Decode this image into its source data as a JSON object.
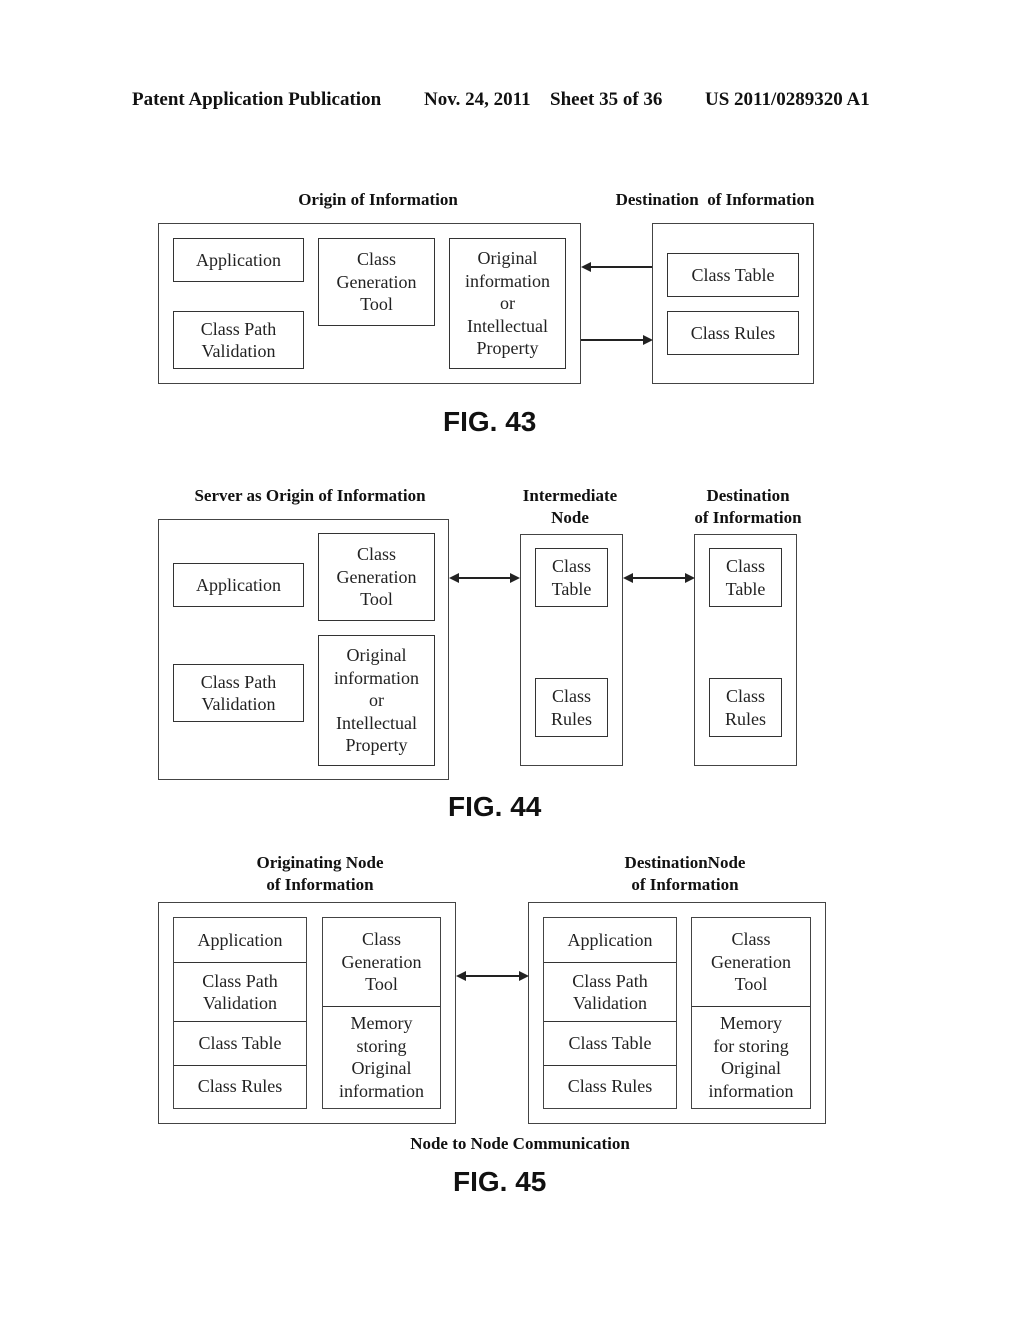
{
  "header": {
    "publication": "Patent Application Publication",
    "date": "Nov. 24, 2011",
    "sheet": "Sheet 35 of 36",
    "number": "US 2011/0289320 A1"
  },
  "fig43": {
    "origin_title": "Origin of Information",
    "destination_title": "Destination  of Information",
    "origin_boxes": {
      "application": "Application",
      "class_path_validation": "Class Path\nValidation",
      "class_generation_tool": "Class\nGeneration\nTool",
      "original_information": "Original\ninformation\nor\nIntellectual\nProperty"
    },
    "destination_boxes": {
      "class_table": "Class Table",
      "class_rules": "Class Rules"
    },
    "label": "FIG. 43"
  },
  "fig44": {
    "server_title": "Server as  Origin of Information",
    "intermediate_title": "Intermediate\nNode",
    "destination_title": "Destination\nof Information",
    "server_boxes": {
      "application": "Application",
      "class_path_validation": "Class Path\nValidation",
      "class_generation_tool": "Class\nGeneration\nTool",
      "original_information": "Original\ninformation\nor\nIntellectual\nProperty"
    },
    "intermediate_boxes": {
      "class_table": "Class\nTable",
      "class_rules": "Class\nRules"
    },
    "destination_boxes": {
      "class_table": "Class\nTable",
      "class_rules": "Class\nRules"
    },
    "label": "FIG. 44"
  },
  "fig45": {
    "originating_title": "Originating Node\nof Information",
    "destination_title": "DestinationNode\nof Information",
    "originating_left": [
      "Application",
      "Class Path\nValidation",
      "Class Table",
      "Class Rules"
    ],
    "originating_right": [
      "Class\nGeneration\nTool",
      "Memory\nstoring\nOriginal\ninformation"
    ],
    "destination_left": [
      "Application",
      "Class Path\nValidation",
      "Class Table",
      "Class Rules"
    ],
    "destination_right": [
      "Class\nGeneration\nTool",
      "Memory\nfor storing\nOriginal\ninformation"
    ],
    "caption": "Node to Node Communication",
    "label": "FIG. 45"
  }
}
